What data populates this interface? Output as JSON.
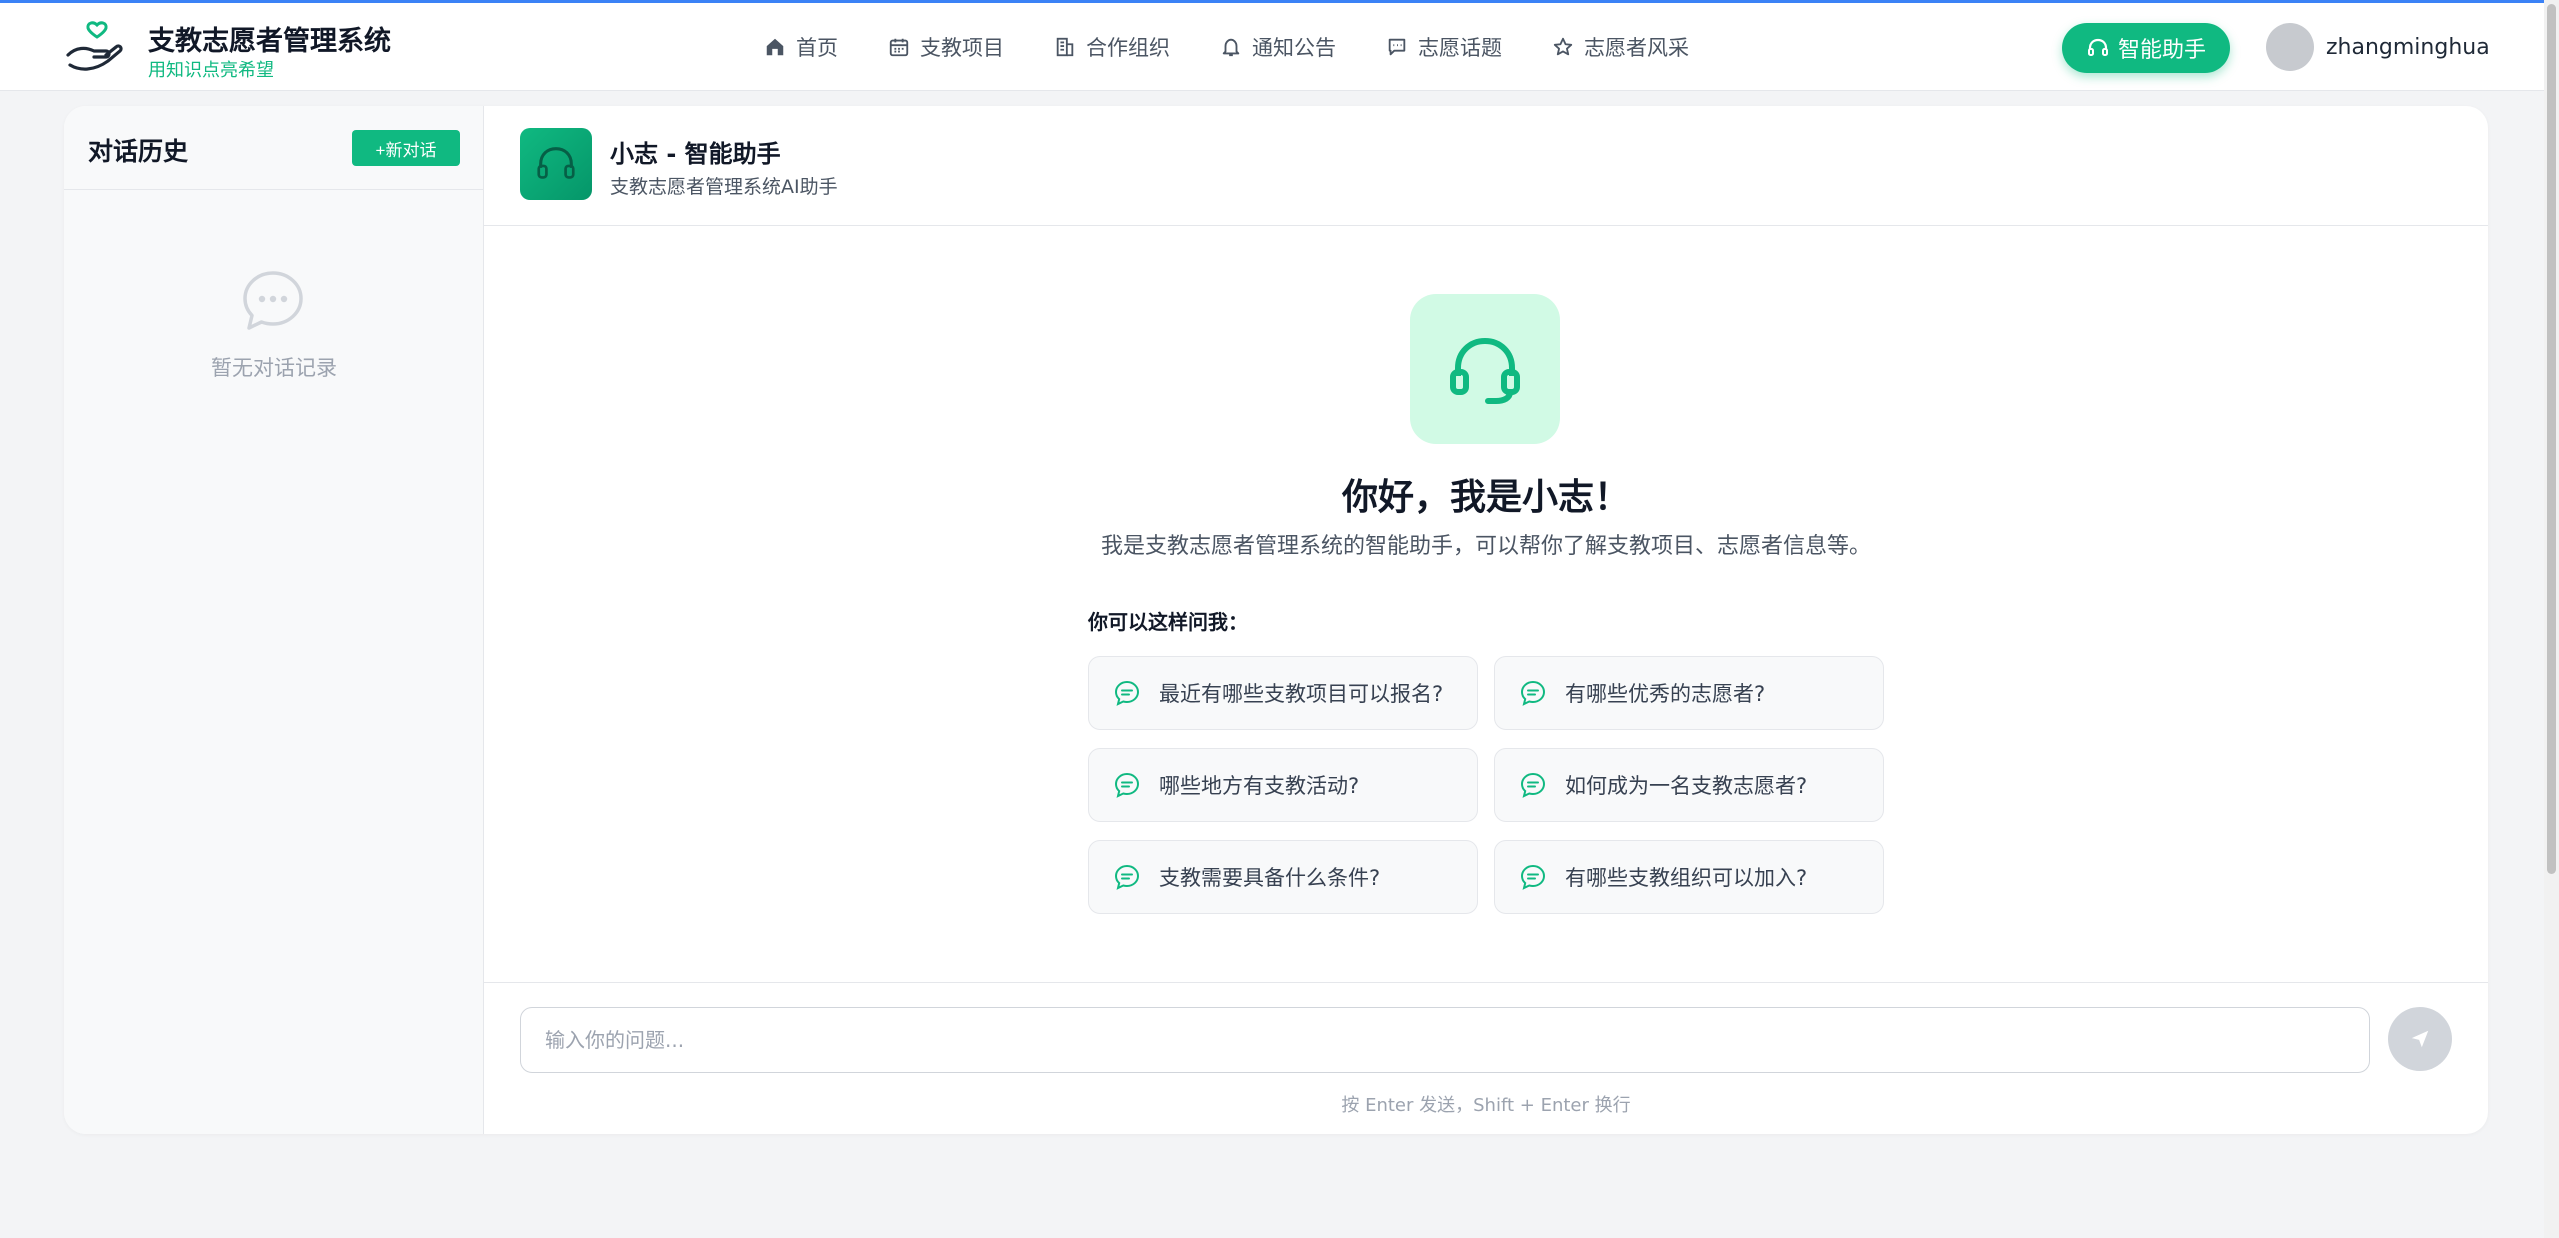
{
  "header": {
    "brand_title": "支教志愿者管理系统",
    "brand_sub": "用知识点亮希望",
    "nav": [
      {
        "label": "首页",
        "icon": "home-icon"
      },
      {
        "label": "支教项目",
        "icon": "calendar-icon"
      },
      {
        "label": "合作组织",
        "icon": "building-icon"
      },
      {
        "label": "通知公告",
        "icon": "bell-icon"
      },
      {
        "label": "志愿话题",
        "icon": "chat-icon"
      },
      {
        "label": "志愿者风采",
        "icon": "star-icon"
      }
    ],
    "ai_button": "智能助手",
    "username": "zhangminghua"
  },
  "sidebar": {
    "title": "对话历史",
    "new_button": "+新对话",
    "empty_text": "暂无对话记录"
  },
  "chat": {
    "bot_name": "小志 - 智能助手",
    "bot_desc": "支教志愿者管理系统AI助手",
    "hero_title": "你好，我是小志！",
    "hero_desc": "我是支教志愿者管理系统的智能助手，可以帮你了解支教项目、志愿者信息等。",
    "ask_label": "你可以这样问我：",
    "suggestions": [
      "最近有哪些支教项目可以报名?",
      "有哪些优秀的志愿者?",
      "哪些地方有支教活动?",
      "如何成为一名支教志愿者?",
      "支教需要具备什么条件?",
      "有哪些支教组织可以加入?"
    ],
    "input_placeholder": "输入你的问题...",
    "input_hint": "按 Enter 发送，Shift + Enter 换行"
  },
  "colors": {
    "accent": "#10b981",
    "background": "#f3f4f6"
  }
}
